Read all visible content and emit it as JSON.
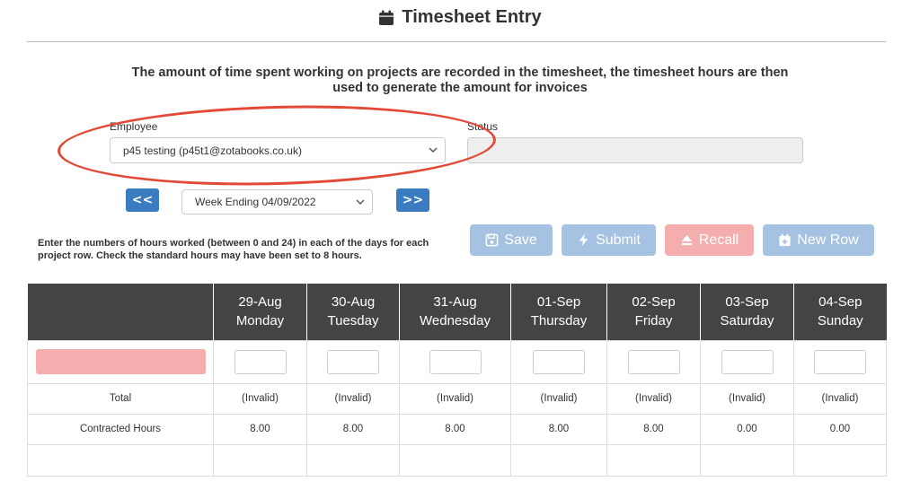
{
  "page": {
    "title": "Timesheet Entry",
    "intro": "The amount of time spent working on projects are recorded in the timesheet, the timesheet hours are then used to generate the amount for invoices"
  },
  "employee": {
    "label": "Employee",
    "value": "p45 testing (p45t1@zotabooks.co.uk)"
  },
  "status": {
    "label": "Status",
    "value": ""
  },
  "week": {
    "prev_label": "<<",
    "next_label": ">>",
    "value": "Week Ending 04/09/2022"
  },
  "hint": "Enter the numbers of hours worked (between 0 and 24) in each of the days for each project row. Check the standard hours may have been set to 8 hours.",
  "actions": {
    "save": "Save",
    "submit": "Submit",
    "recall": "Recall",
    "new_row": "New Row"
  },
  "colors": {
    "primary": "#3b7bbf",
    "disabled_blue": "#a6c2e2",
    "disabled_red": "#f4aeae",
    "header_bg": "#444444",
    "annotation": "#e24a37"
  },
  "table": {
    "days": [
      {
        "date": "29-Aug",
        "day": "Monday"
      },
      {
        "date": "30-Aug",
        "day": "Tuesday"
      },
      {
        "date": "31-Aug",
        "day": "Wednesday"
      },
      {
        "date": "01-Sep",
        "day": "Thursday"
      },
      {
        "date": "02-Sep",
        "day": "Friday"
      },
      {
        "date": "03-Sep",
        "day": "Saturday"
      },
      {
        "date": "04-Sep",
        "day": "Sunday"
      }
    ],
    "total_label": "Total",
    "totals": [
      "(Invalid)",
      "(Invalid)",
      "(Invalid)",
      "(Invalid)",
      "(Invalid)",
      "(Invalid)",
      "(Invalid)"
    ],
    "contracted_label": "Contracted Hours",
    "contracted": [
      "8.00",
      "8.00",
      "8.00",
      "8.00",
      "8.00",
      "0.00",
      "0.00"
    ]
  }
}
